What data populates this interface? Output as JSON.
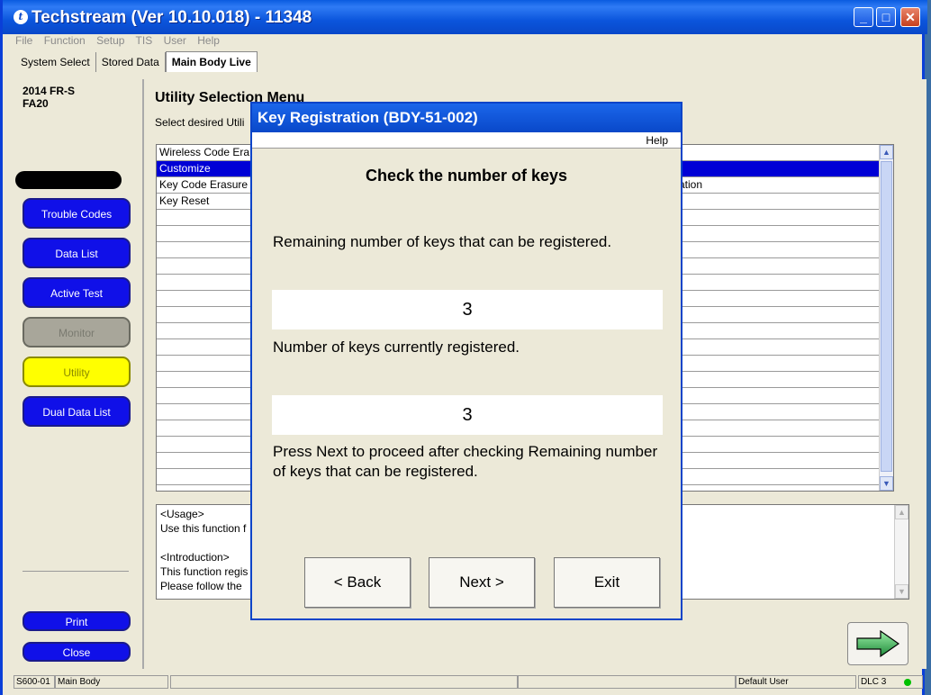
{
  "window": {
    "title": "Techstream (Ver 10.10.018) - 11348",
    "icon_letter": "t"
  },
  "menu": [
    "File",
    "Function",
    "Setup",
    "TIS",
    "User",
    "Help"
  ],
  "tabs": [
    "System Select",
    "Stored Data",
    "Main Body Live"
  ],
  "sidebar": {
    "model": "2014 FR-S",
    "code": "FA20",
    "buttons": [
      "Trouble Codes",
      "Data List",
      "Active Test",
      "Monitor",
      "Utility",
      "Dual Data List"
    ],
    "print": "Print",
    "close": "Close"
  },
  "main": {
    "title": "Utility Selection Menu",
    "subtitle": "Select desired Utili",
    "list": [
      "Wireless Code Era",
      "Customize",
      "Key Code Erasure",
      "Key Reset"
    ],
    "list_tail": "ration",
    "desc": [
      "<Usage>",
      "Use this function f",
      "",
      "<Introduction>",
      "This function regis",
      "Please follow the"
    ]
  },
  "status": {
    "code": "S600-01",
    "system": "Main Body",
    "user": "Default User",
    "dlc": "DLC 3"
  },
  "dialog": {
    "title": "Key Registration (BDY-51-002)",
    "help": "Help",
    "heading": "Check the number of keys",
    "remaining_label": "Remaining number of keys that can be registered.",
    "remaining_value": "3",
    "registered_label": "Number of keys currently registered.",
    "registered_value": "3",
    "instruction": "Press Next to proceed after checking Remaining number of keys that can be registered.",
    "back": "< Back",
    "next": "Next >",
    "exit": "Exit"
  },
  "colors": {
    "title_blue": "#0a47c8",
    "selection_blue": "#0000d6",
    "button_blue": "#1010e8",
    "utility_yellow": "#ffff00",
    "status_green": "#00c000"
  }
}
